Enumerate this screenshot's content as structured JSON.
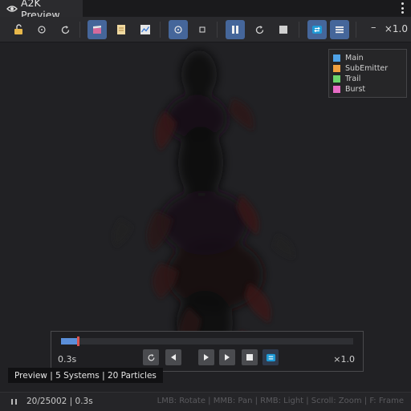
{
  "window": {
    "title": "A2K Preview"
  },
  "toolbar": {
    "zoom": "×1.0",
    "minus": "–"
  },
  "legend": {
    "items": [
      {
        "label": "Main",
        "color": "#4fa3e8"
      },
      {
        "label": "SubEmitter",
        "color": "#f0a040"
      },
      {
        "label": "Trail",
        "color": "#6cd46c"
      },
      {
        "label": "Burst",
        "color": "#e86cc6"
      }
    ]
  },
  "playback": {
    "time": "0.3s",
    "rate": "×1.0",
    "progress": 0.055
  },
  "info": {
    "text": "Preview | 5 Systems | 20 Particles"
  },
  "status": {
    "frame": "20/25002 | 0.3s",
    "hints": "LMB: Rotate | MMB: Pan | RMB: Light | Scroll: Zoom | F: Frame"
  },
  "colors": {
    "accent": "#45669a",
    "progress": "#5b8fd9",
    "playhead": "#d9534f"
  }
}
